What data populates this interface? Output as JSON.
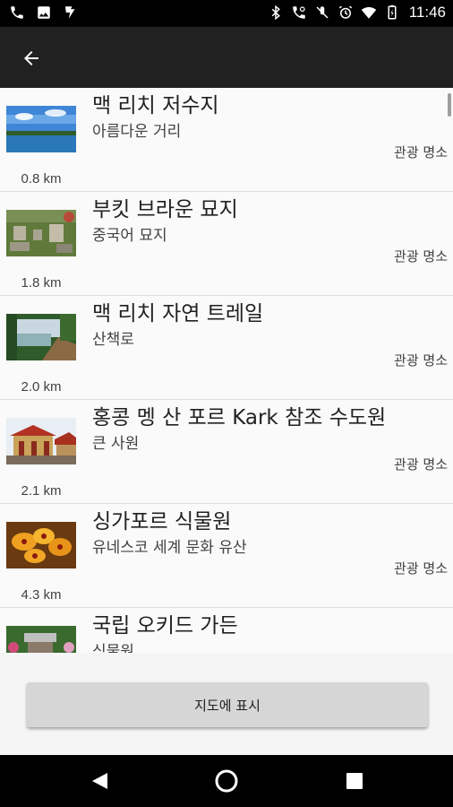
{
  "status_bar": {
    "time": "11:46",
    "left_icons": [
      "phone-icon",
      "image-icon",
      "task-icon"
    ],
    "right_icons": [
      "bluetooth-icon",
      "call-settings-icon",
      "mute-icon",
      "alarm-icon",
      "wifi-icon",
      "battery-icon"
    ]
  },
  "app_bar": {
    "back_icon": "arrow-left-icon"
  },
  "places": [
    {
      "name": "맥 리치 저수지",
      "subtitle": "아름다운 거리",
      "category": "관광 명소",
      "distance": "0.8 km"
    },
    {
      "name": "부킷 브라운 묘지",
      "subtitle": "중국어 묘지",
      "category": "관광 명소",
      "distance": "1.8 km"
    },
    {
      "name": "맥 리치 자연 트레일",
      "subtitle": "산책로",
      "category": "관광 명소",
      "distance": "2.0 km"
    },
    {
      "name": "홍콩 멩 산 포르 Kark 참조 수도원",
      "subtitle": "큰 사원",
      "category": "관광 명소",
      "distance": "2.1 km"
    },
    {
      "name": "싱가포르 식물원",
      "subtitle": "유네스코 세계 문화 유산",
      "category": "관광 명소",
      "distance": "4.3 km"
    },
    {
      "name": "국립 오키드 가든",
      "subtitle": "식물원",
      "category": "",
      "distance": ""
    }
  ],
  "map_button": {
    "label": "지도에 표시"
  },
  "nav_bar": {
    "icons": [
      "back-triangle-icon",
      "home-circle-icon",
      "recents-square-icon"
    ]
  }
}
